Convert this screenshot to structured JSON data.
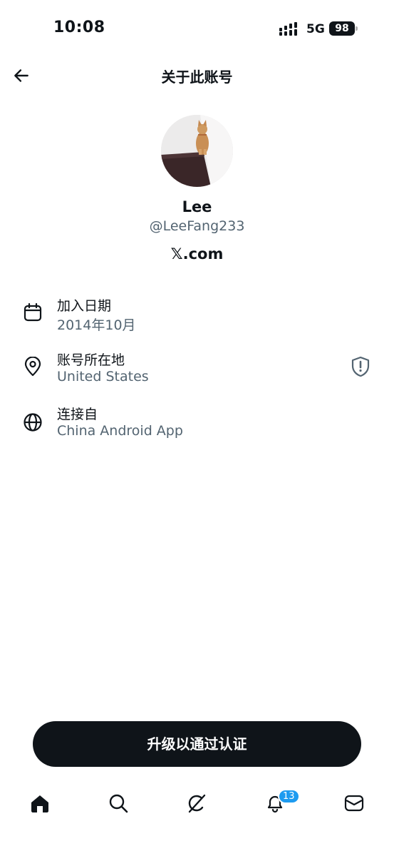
{
  "status_bar": {
    "time": "10:08",
    "network": "5G",
    "battery": "98"
  },
  "header": {
    "title": "关于此账号"
  },
  "profile": {
    "display_name": "Lee",
    "handle": "@LeeFang233",
    "site": "𝕏.com"
  },
  "info": [
    {
      "label": "加入日期",
      "value": "2014年10月",
      "icon": "calendar-icon"
    },
    {
      "label": "账号所在地",
      "value": "United States",
      "icon": "location-pin-icon"
    },
    {
      "label": "连接自",
      "value": "China Android App",
      "icon": "globe-icon"
    }
  ],
  "upgrade_button": {
    "label": "升级以通过认证"
  },
  "bottom_nav": {
    "items": [
      "home-icon",
      "search-icon",
      "grok-icon",
      "notifications-icon",
      "messages-icon"
    ],
    "notification_count": "13"
  },
  "colors": {
    "text_primary": "#0f1419",
    "text_secondary": "#536471",
    "accent": "#1d9bf0"
  }
}
